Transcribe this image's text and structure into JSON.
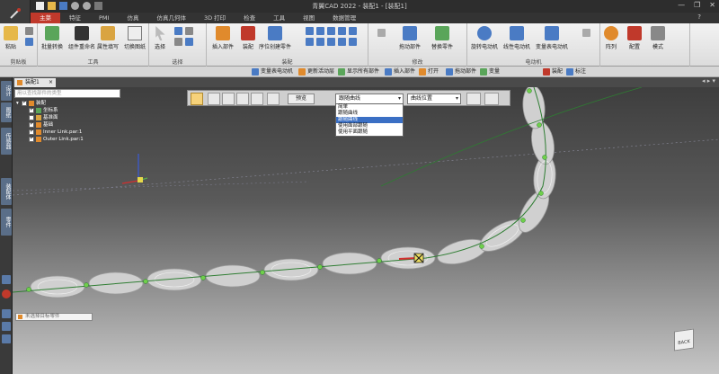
{
  "window": {
    "title": "青翼CAD 2022 - 装配1 - [装配1]",
    "controls": [
      "—",
      "❐",
      "✕"
    ]
  },
  "ribbon": {
    "tabs": [
      "主菜",
      "特征",
      "PMI",
      "仿真",
      "仿真几何体",
      "3D 打印",
      "检查",
      "工具",
      "视图",
      "数据管理"
    ],
    "active_tab": "主菜",
    "help": "?",
    "groups": [
      {
        "label": "剪贴板",
        "buttons": [
          "粘贴"
        ]
      },
      {
        "label": "工具",
        "buttons": [
          "批量转换",
          "组件重命名",
          "属性填写",
          "切换图纸"
        ]
      },
      {
        "label": "选择",
        "buttons": [
          "选择"
        ]
      },
      {
        "label": "装配",
        "buttons": [
          "插入部件",
          "装配",
          "序位创建零件"
        ]
      },
      {
        "label": "修改",
        "buttons": [
          "拖动部件",
          "替换零件"
        ]
      },
      {
        "label": "电动机",
        "buttons": [
          "旋转电动机",
          "线性电动机",
          "变量表电动机"
        ]
      },
      {
        "label": "",
        "buttons": [
          "阵列",
          "配置",
          "模式"
        ]
      }
    ]
  },
  "cmdbar": {
    "items": [
      "变量表电动机",
      "更新活动层",
      "显示所有部件",
      "插入部件",
      "打开",
      "拖动部件",
      "变量",
      "装配",
      "标注"
    ]
  },
  "leftbar": {
    "tabs": [
      "设计",
      "图纸",
      "传感器",
      "装配体",
      "零件"
    ]
  },
  "document": {
    "tab_label": "装配1",
    "close": "×",
    "strip_controls": "◂ ▸ ▾"
  },
  "tree": {
    "search_placeholder": "用以查找部件的类型",
    "rows": [
      {
        "label": "装配",
        "level": 0,
        "checked": true
      },
      {
        "label": "坐标系",
        "level": 1,
        "checked": true
      },
      {
        "label": "基准面",
        "level": 1,
        "checked": false
      },
      {
        "label": "基础",
        "level": 1,
        "checked": true
      },
      {
        "label": "Inner Link.par:1",
        "level": 1,
        "checked": true
      },
      {
        "label": "Outer Link.par:1",
        "level": 1,
        "checked": true
      }
    ]
  },
  "edit_toolbar": {
    "preview_label": "预览",
    "path_select": "跟随曲线",
    "position_select": "曲线位置",
    "dropdown_options": [
      "简单",
      "跟随曲线",
      "跟随曲线",
      "使用面部跟随",
      "使用平面跟随"
    ],
    "dropdown_selected_index": 2
  },
  "status": {
    "text": "未选择目标零件"
  },
  "navcube": {
    "label": "BACK"
  },
  "colors": {
    "accent": "#c0392b",
    "chain_path": "#2e7d32",
    "chain_joint": "#6fcf4a"
  }
}
